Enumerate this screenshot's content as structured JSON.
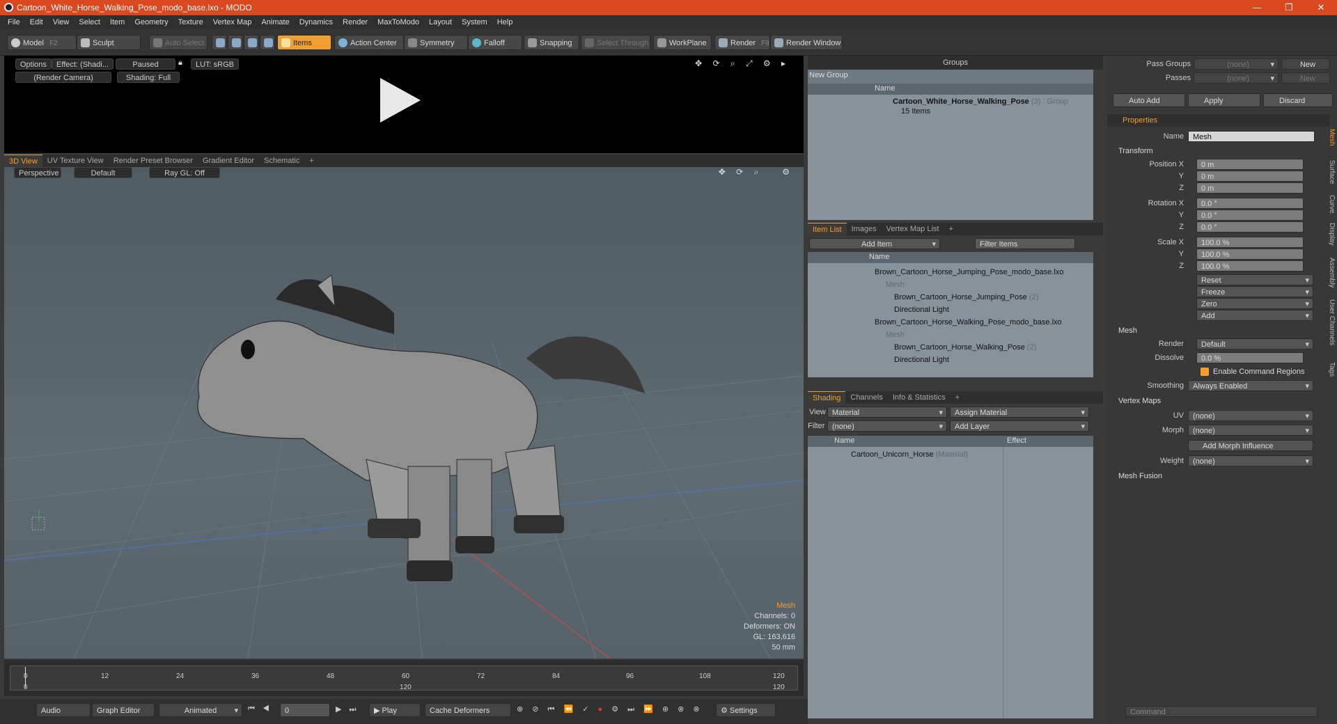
{
  "window": {
    "title": "Cartoon_White_Horse_Walking_Pose_modo_base.lxo - MODO",
    "minimize": "—",
    "maximize": "❐",
    "close": "✕"
  },
  "menu": [
    "File",
    "Edit",
    "View",
    "Select",
    "Item",
    "Geometry",
    "Texture",
    "Vertex Map",
    "Animate",
    "Dynamics",
    "Render",
    "MaxToModo",
    "Layout",
    "System",
    "Help"
  ],
  "toolbar": {
    "model": "Model",
    "model_key": "F2",
    "sculpt": "Sculpt",
    "auto_select": "Auto Select",
    "items": "Items",
    "action_center": "Action Center",
    "symmetry": "Symmetry",
    "falloff": "Falloff",
    "snapping": "Snapping",
    "select_through": "Select Through",
    "workplane": "WorkPlane",
    "render": "Render",
    "render_key": "F9",
    "render_window": "Render Window"
  },
  "preview": {
    "options": "Options",
    "effect": "Effect: (Shadi...",
    "paused": "Paused",
    "lut": "LUT: sRGB",
    "camera": "(Render Camera)",
    "shading": "Shading: Full"
  },
  "viewtabs": [
    "3D View",
    "UV Texture View",
    "Render Preset Browser",
    "Gradient Editor",
    "Schematic",
    "+"
  ],
  "viewport": {
    "perspective": "Perspective",
    "default": "Default",
    "raygl": "Ray GL: Off",
    "info_title": "Mesh",
    "channels": "Channels: 0",
    "deformers": "Deformers: ON",
    "gl": "GL: 163,616",
    "mm": "50 mm"
  },
  "timeline": {
    "ticks": [
      "0",
      "12",
      "24",
      "36",
      "48",
      "60",
      "72",
      "84",
      "96",
      "108",
      "120"
    ],
    "start": "0",
    "mid": "120",
    "end": "120"
  },
  "bottom": {
    "audio": "Audio",
    "graph_editor": "Graph Editor",
    "animated": "Animated",
    "frame": "0",
    "play": "Play",
    "cache": "Cache Deformers",
    "settings": "Settings"
  },
  "groups": {
    "title": "Groups",
    "new_group": "New Group",
    "name_col": "Name",
    "item_name": "Cartoon_White_Horse_Walking_Pose",
    "item_suffix": "(3) : Group",
    "item_count": "15 Items"
  },
  "itemlist": {
    "tabs": [
      "Item List",
      "Images",
      "Vertex Map List",
      "+"
    ],
    "add_item": "Add Item",
    "filter": "Filter Items",
    "name_col": "Name",
    "rows": [
      {
        "t": "Brown_Cartoon_Horse_Jumping_Pose_modo_base.lxo",
        "g": false
      },
      {
        "t": "Mesh",
        "g": true
      },
      {
        "t": "Brown_Cartoon_Horse_Jumping_Pose",
        "s": "(2)",
        "g": false
      },
      {
        "t": "Directional Light",
        "g": false
      },
      {
        "t": "Brown_Cartoon_Horse_Walking_Pose_modo_base.lxo",
        "g": false
      },
      {
        "t": "Mesh",
        "g": true
      },
      {
        "t": "Brown_Cartoon_Horse_Walking_Pose",
        "s": "(2)",
        "g": false
      },
      {
        "t": "Directional Light",
        "g": false
      }
    ]
  },
  "shading": {
    "tabs": [
      "Shading",
      "Channels",
      "Info & Statistics",
      "+"
    ],
    "view_label": "View",
    "view_val": "Material",
    "assign": "Assign Material",
    "filter_label": "Filter",
    "filter_val": "(none)",
    "add_layer": "Add Layer",
    "name_col": "Name",
    "effect_col": "Effect",
    "row": "Cartoon_Unicorn_Horse",
    "row_suffix": "(Material)"
  },
  "props": {
    "pass_groups": "Pass Groups",
    "passes": "Passes",
    "none": "(none)",
    "new": "New",
    "auto_add": "Auto Add",
    "apply": "Apply",
    "discard": "Discard",
    "tab": "Properties",
    "name_label": "Name",
    "name_val": "Mesh",
    "transform": "Transform",
    "pos_x": "Position X",
    "y": "Y",
    "z": "Z",
    "zero_m": "0 m",
    "rot_x": "Rotation X",
    "zero_deg": "0.0 °",
    "scale_x": "Scale X",
    "pct": "100.0 %",
    "reset": "Reset",
    "freeze": "Freeze",
    "zero": "Zero",
    "add": "Add",
    "mesh": "Mesh",
    "render": "Render",
    "render_val": "Default",
    "dissolve": "Dissolve",
    "dissolve_val": "0.0 %",
    "cmd_regions": "Enable Command Regions",
    "smoothing": "Smoothing",
    "smoothing_val": "Always Enabled",
    "vertex_maps": "Vertex Maps",
    "uv": "UV",
    "morph": "Morph",
    "add_morph": "Add Morph Influence",
    "weight": "Weight",
    "mesh_fusion": "Mesh Fusion",
    "command": "Command",
    "vtabs": [
      "Mesh",
      "Surface",
      "Curve",
      "Display",
      "Assembly",
      "User Channels",
      "Tags"
    ]
  }
}
